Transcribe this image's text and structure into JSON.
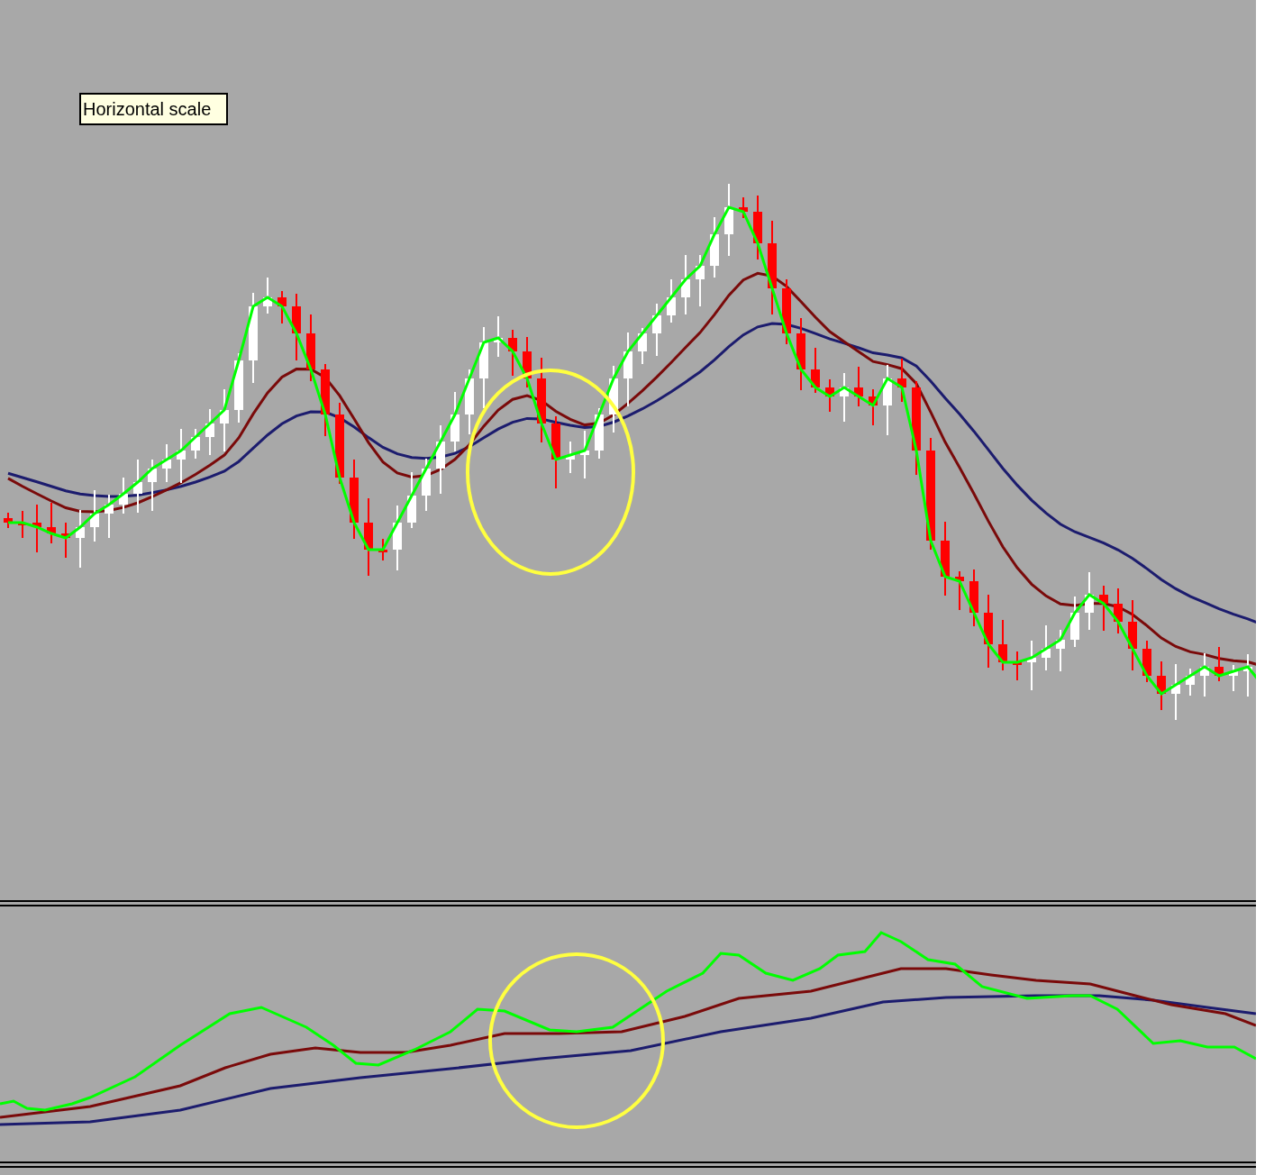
{
  "tooltip": {
    "text": "Horizontal scale"
  }
}
